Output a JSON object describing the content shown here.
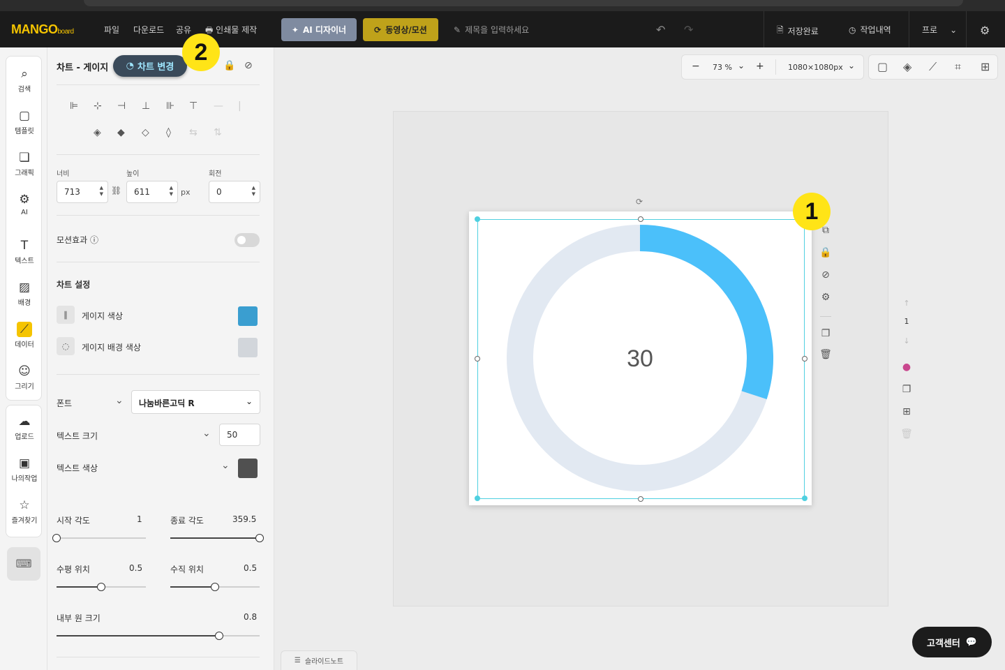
{
  "app": {
    "logo_main": "MANGO",
    "logo_sub": "board"
  },
  "topbar": {
    "menu": [
      "파일",
      "다운로드",
      "공유",
      "인쇄물 제작"
    ],
    "ai_designer": "AI 디자이너",
    "video_motion": "동영상/모션",
    "title_placeholder": "제목을 입력하세요",
    "save_status": "저장완료",
    "history": "작업내역",
    "plan": "프로"
  },
  "leftnav": {
    "items": [
      {
        "label": "검색",
        "icon": "search-icon"
      },
      {
        "label": "템플릿",
        "icon": "template-icon"
      },
      {
        "label": "그래픽",
        "icon": "graphic-icon"
      },
      {
        "label": "AI",
        "icon": "ai-chip-icon"
      },
      {
        "label": "텍스트",
        "icon": "text-icon"
      },
      {
        "label": "배경",
        "icon": "background-icon"
      },
      {
        "label": "데이터",
        "icon": "chart-line-icon"
      },
      {
        "label": "그리기",
        "icon": "draw-icon"
      }
    ],
    "items2": [
      {
        "label": "업로드",
        "icon": "upload-icon"
      },
      {
        "label": "나의작업",
        "icon": "my-work-icon"
      },
      {
        "label": "즐겨찾기",
        "icon": "favorite-icon"
      }
    ]
  },
  "panel": {
    "title": "차트 - 게이지",
    "change_chart": "차트 변경",
    "width_label": "너비",
    "height_label": "높이",
    "rotation_label": "회전",
    "width": "713",
    "height": "611",
    "unit": "px",
    "rotation": "0",
    "motion_label": "모션효과",
    "chart_settings": "차트 설정",
    "gauge_color_label": "게이지 색상",
    "gauge_bg_label": "게이지 배경 색상",
    "gauge_color": "#3a9ed0",
    "gauge_bg_color": "#d2d6db",
    "font_label": "폰트",
    "font_value": "나눔바른고딕 R",
    "text_size_label": "텍스트 크기",
    "text_size": "50",
    "text_color_label": "텍스트 색상",
    "text_color": "#505050",
    "start_angle_label": "시작 각도",
    "start_angle": "1",
    "end_angle_label": "종료 각도",
    "end_angle": "359.5",
    "h_pos_label": "수평 위치",
    "h_pos": "0.5",
    "v_pos_label": "수직 위치",
    "v_pos": "0.5",
    "inner_label": "내부 원 크기",
    "inner": "0.8",
    "sliders": {
      "start_angle_pct": 0.0,
      "end_angle_pct": 1.0,
      "h_pos_pct": 0.5,
      "v_pos_pct": 0.5,
      "inner_pct": 0.8
    }
  },
  "canvas": {
    "zoom": "73 %",
    "size": "1080×1080px",
    "page_number": "1",
    "customer_center": "고객센터",
    "slide_notes": "슬라이드노트"
  },
  "badges": {
    "one": "1",
    "two": "2"
  },
  "chart_data": {
    "type": "gauge",
    "value": 30,
    "max": 100,
    "value_label": "30",
    "gauge_color": "#4bc0fa",
    "background_color": "#e2e9f2",
    "text_color": "#555555"
  }
}
